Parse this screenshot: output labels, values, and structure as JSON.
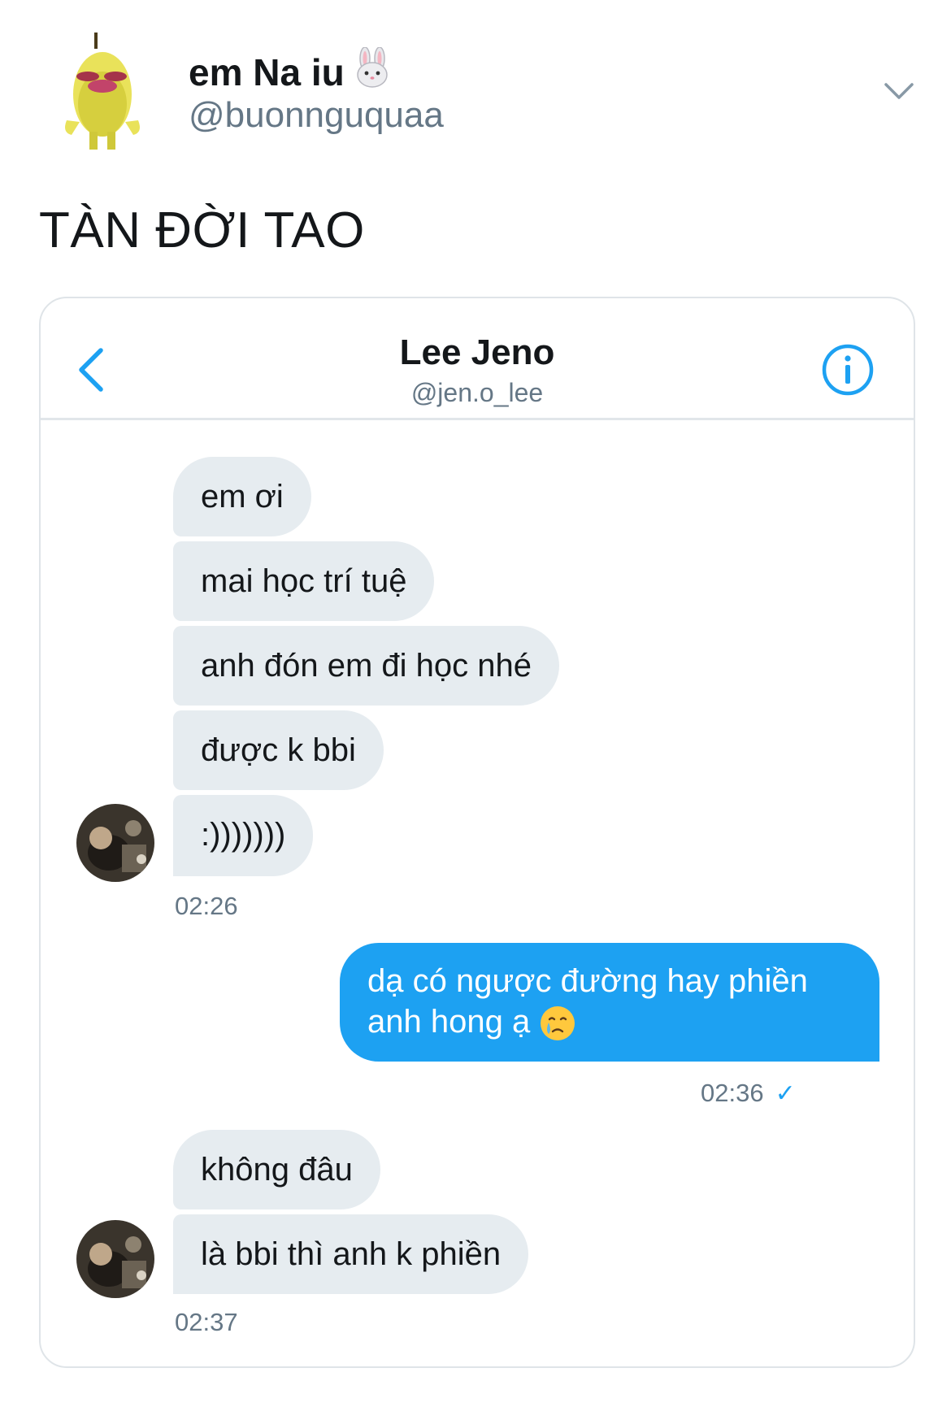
{
  "tweet": {
    "author_name": "em Na iu",
    "author_emoji": "rabbit-face",
    "author_handle": "@buonnguquaa",
    "text": "TÀN ĐỜI TAO"
  },
  "dm": {
    "contact_name": "Lee Jeno",
    "contact_handle": "@jen.o_lee",
    "groups": [
      {
        "sender": "contact",
        "messages": [
          "em ơi",
          "mai học trí tuệ",
          "anh đón em đi học nhé",
          "được k bbi",
          ":)))))))"
        ],
        "time": "02:26"
      },
      {
        "sender": "me",
        "messages": [
          "dạ có ngược đường hay phiền anh hong ạ"
        ],
        "emoji": "crying-face",
        "time": "02:36",
        "read_receipt": "✓"
      },
      {
        "sender": "contact",
        "messages": [
          "không đâu",
          "là bbi thì anh k phiền"
        ],
        "time": "02:37"
      }
    ]
  },
  "colors": {
    "accent": "#1da1f2",
    "incoming_bubble": "#e6ecf0",
    "secondary_text": "#657786",
    "border": "#e1e6ea"
  }
}
